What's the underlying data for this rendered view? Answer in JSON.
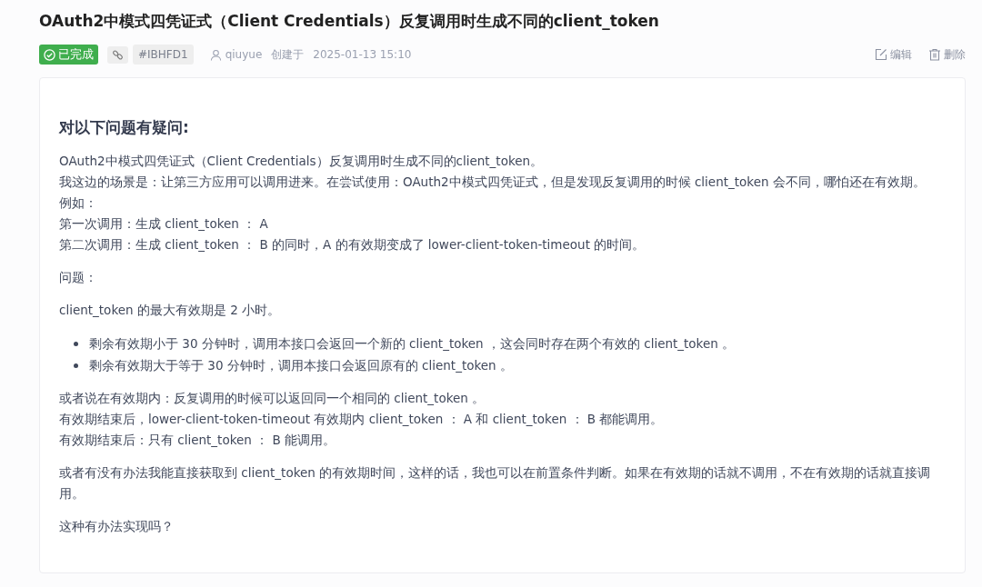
{
  "title": "OAuth2中模式四凭证式（Client Credentials）反复调用时生成不同的client_token",
  "meta": {
    "status": {
      "label": "已完成",
      "done": true
    },
    "issue_id": "#IBHFD1",
    "author": "qiuyue",
    "created_label": "创建于",
    "created_at": "2025-01-13 15:10"
  },
  "actions": [
    {
      "kind": "edit",
      "label": "编辑"
    },
    {
      "kind": "delete",
      "label": "删除"
    }
  ],
  "blocks": [
    {
      "kind": "heading",
      "text": "对以下问题有疑问:"
    },
    {
      "kind": "lines",
      "lines": [
        "OAuth2中模式四凭证式（Client Credentials）反复调用时生成不同的client_token。",
        "我这边的场景是：让第三方应用可以调用进来。在尝试使用：OAuth2中模式四凭证式，但是发现反复调用的时候 client_token 会不同，哪怕还在有效期。",
        "例如：",
        "第一次调用：生成 client_token ： A",
        "第二次调用：生成 client_token ： B 的同时，A 的有效期变成了 lower-client-token-timeout 的时间。"
      ]
    },
    {
      "kind": "lines",
      "lines": [
        "问题："
      ]
    },
    {
      "kind": "lines",
      "lines": [
        "client_token 的最大有效期是 2 小时。"
      ]
    },
    {
      "kind": "list",
      "items": [
        "剩余有效期小于 30 分钟时，调用本接口会返回一个新的 client_token ，这会同时存在两个有效的 client_token 。",
        "剩余有效期大于等于 30 分钟时，调用本接口会返回原有的 client_token 。"
      ]
    },
    {
      "kind": "lines",
      "lines": [
        "或者说在有效期内：反复调用的时候可以返回同一个相同的 client_token 。",
        "有效期结束后，lower-client-token-timeout 有效期内 client_token ： A 和 client_token ： B 都能调用。",
        "有效期结束后：只有 client_token ： B 能调用。"
      ]
    },
    {
      "kind": "lines",
      "lines": [
        "或者有没有办法我能直接获取到 client_token 的有效期时间，这样的话，我也可以在前置条件判断。如果在有效期的话就不调用，不在有效期的话就直接调用。"
      ]
    },
    {
      "kind": "lines",
      "lines": [
        "这种有办法实现吗？"
      ]
    }
  ]
}
